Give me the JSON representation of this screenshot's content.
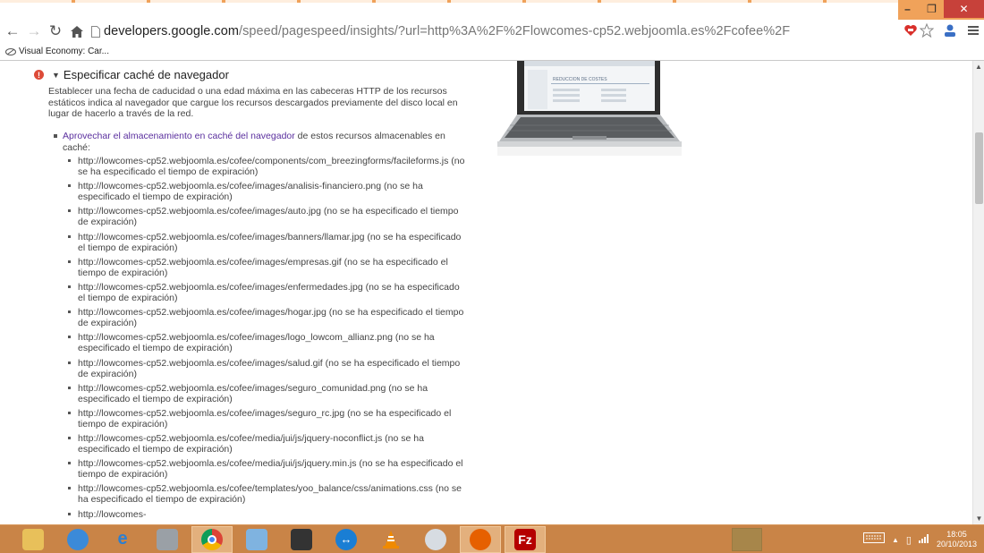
{
  "browser": {
    "url_host": "developers.google.com",
    "url_path": "/speed/pagespeed/insights/?url=http%3A%2F%2Flowcomes-cp52.webjoomla.es%2Fcofee%2F",
    "bookmark": "Visual Economy: Car..."
  },
  "rule": {
    "title": "Especificar caché de navegador",
    "description": "Establecer una fecha de caducidad o una edad máxima en las cabeceras HTTP de los recursos estáticos indica al navegador que cargue los recursos descargados previamente del disco local en lugar de hacerlo a través de la red.",
    "suggestion_link": "Aprovechar el almacenamiento en caché del navegador",
    "suggestion_rest": " de estos recursos almacenables en caché:",
    "resources": [
      "http://lowcomes-cp52.webjoomla.es/cofee/components/com_breezingforms/facileforms.js (no se ha especificado el tiempo de expiración)",
      "http://lowcomes-cp52.webjoomla.es/cofee/images/analisis-financiero.png (no se ha especificado el tiempo de expiración)",
      "http://lowcomes-cp52.webjoomla.es/cofee/images/auto.jpg (no se ha especificado el tiempo de expiración)",
      "http://lowcomes-cp52.webjoomla.es/cofee/images/banners/llamar.jpg (no se ha especificado el tiempo de expiración)",
      "http://lowcomes-cp52.webjoomla.es/cofee/images/empresas.gif (no se ha especificado el tiempo de expiración)",
      "http://lowcomes-cp52.webjoomla.es/cofee/images/enfermedades.jpg (no se ha especificado el tiempo de expiración)",
      "http://lowcomes-cp52.webjoomla.es/cofee/images/hogar.jpg (no se ha especificado el tiempo de expiración)",
      "http://lowcomes-cp52.webjoomla.es/cofee/images/logo_lowcom_allianz.png (no se ha especificado el tiempo de expiración)",
      "http://lowcomes-cp52.webjoomla.es/cofee/images/salud.gif (no se ha especificado el tiempo de expiración)",
      "http://lowcomes-cp52.webjoomla.es/cofee/images/seguro_comunidad.png (no se ha especificado el tiempo de expiración)",
      "http://lowcomes-cp52.webjoomla.es/cofee/images/seguro_rc.jpg (no se ha especificado el tiempo de expiración)",
      "http://lowcomes-cp52.webjoomla.es/cofee/media/jui/js/jquery-noconflict.js (no se ha especificado el tiempo de expiración)",
      "http://lowcomes-cp52.webjoomla.es/cofee/media/jui/js/jquery.min.js (no se ha especificado el tiempo de expiración)",
      "http://lowcomes-cp52.webjoomla.es/cofee/templates/yoo_balance/css/animations.css (no se ha especificado el tiempo de expiración)",
      "http://lowcomes-"
    ]
  },
  "laptop_screen": {
    "heading": "REDUCCION DE COSTES"
  },
  "taskbar": {
    "time": "18:05",
    "date": "20/10/2013"
  }
}
